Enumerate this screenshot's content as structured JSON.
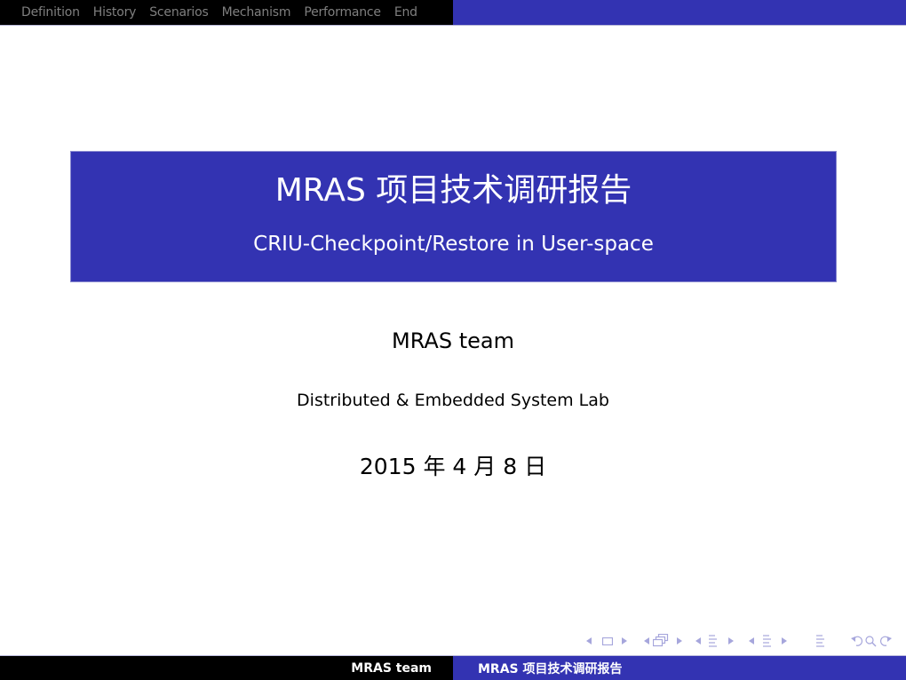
{
  "header": {
    "sections": [
      "Definition",
      "History",
      "Scenarios",
      "Mechanism",
      "Performance",
      "End"
    ]
  },
  "title_slide": {
    "title": "MRAS 项目技术调研报告",
    "subtitle": "CRIU-Checkpoint/Restore in User-space",
    "author": "MRAS team",
    "institute": "Distributed & Embedded System Lab",
    "date": "2015 年 4 月 8 日"
  },
  "navigation_symbols": [
    {
      "name": "prev-slide-arrow",
      "icon": "triangle-left"
    },
    {
      "name": "slide-icon",
      "icon": "frame"
    },
    {
      "name": "next-slide-arrow",
      "icon": "triangle-right"
    },
    {
      "name": "prev-frame-arrow",
      "icon": "triangle-left"
    },
    {
      "name": "frames-icon",
      "icon": "stacked-frames"
    },
    {
      "name": "next-frame-arrow",
      "icon": "triangle-right"
    },
    {
      "name": "prev-subsection-arrow",
      "icon": "triangle-left"
    },
    {
      "name": "subsection-icon",
      "icon": "lines"
    },
    {
      "name": "next-subsection-arrow",
      "icon": "triangle-right"
    },
    {
      "name": "prev-section-arrow",
      "icon": "triangle-left"
    },
    {
      "name": "section-icon",
      "icon": "lines"
    },
    {
      "name": "next-section-arrow",
      "icon": "triangle-right"
    },
    {
      "name": "document-icon",
      "icon": "lines"
    },
    {
      "name": "back-icon",
      "icon": "undo"
    },
    {
      "name": "search-icon",
      "icon": "magnifier"
    },
    {
      "name": "forward-icon",
      "icon": "redo"
    }
  ],
  "footer": {
    "author": "MRAS team",
    "title": "MRAS 项目技术调研报告"
  },
  "colors": {
    "structure_blue": "#3333b2",
    "bar_black": "#000000",
    "nav_inactive": "#7f7f7f",
    "nav_symbol": "#a6a6dc"
  }
}
